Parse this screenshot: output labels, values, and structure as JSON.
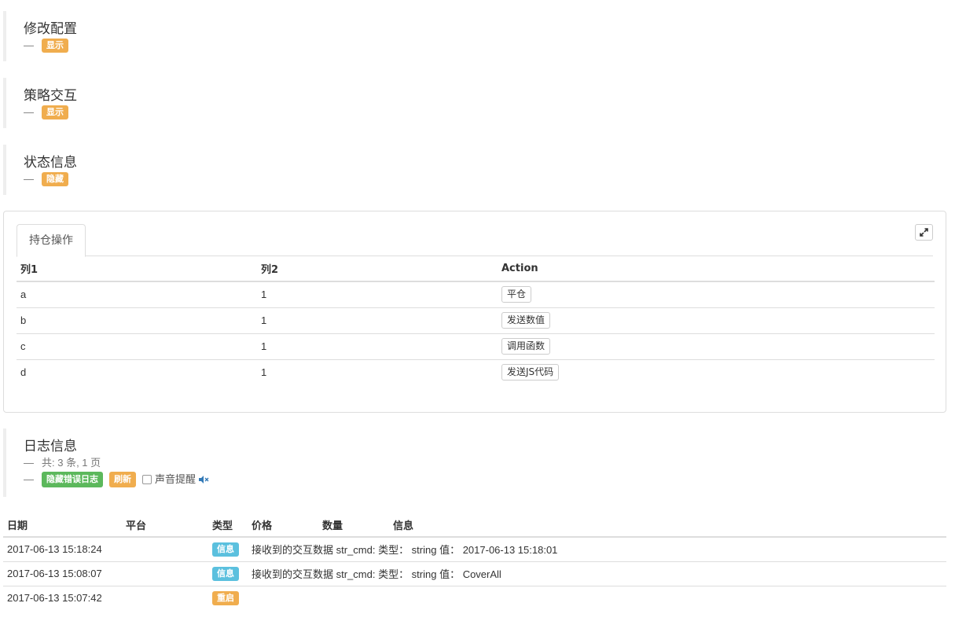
{
  "sections": {
    "config": {
      "title": "修改配置",
      "dash": "—",
      "toggle": "显示"
    },
    "interaction": {
      "title": "策略交互",
      "dash": "—",
      "toggle": "显示"
    },
    "status": {
      "title": "状态信息",
      "dash": "—",
      "toggle": "隐藏"
    }
  },
  "panel": {
    "tab": "持仓操作",
    "expand_icon": "expand-icon",
    "columns": [
      "列1",
      "列2",
      "Action"
    ],
    "rows": [
      {
        "c1": "a",
        "c2": "1",
        "action": "平仓"
      },
      {
        "c1": "b",
        "c2": "1",
        "action": "发送数值"
      },
      {
        "c1": "c",
        "c2": "1",
        "action": "调用函数"
      },
      {
        "c1": "d",
        "c2": "1",
        "action": "发送JS代码"
      }
    ]
  },
  "logs_section": {
    "title": "日志信息",
    "dash": "—",
    "summary": "共: 3 条, 1 页",
    "hide_errors": "隐藏错误日志",
    "refresh": "刷新",
    "sound_label": "声音提醒",
    "sound_icon": "speaker-muted-icon"
  },
  "logs": {
    "columns": [
      "日期",
      "平台",
      "类型",
      "价格",
      "数量",
      "信息"
    ],
    "rows": [
      {
        "date": "2017-06-13 15:18:24",
        "platform": "",
        "type": "信息",
        "type_color": "#5bc0de",
        "price": "",
        "amount": "",
        "info": "接收到的交互数据 str_cmd: 类型： string 值： 2017-06-13 15:18:01"
      },
      {
        "date": "2017-06-13 15:08:07",
        "platform": "",
        "type": "信息",
        "type_color": "#5bc0de",
        "price": "",
        "amount": "",
        "info": "接收到的交互数据 str_cmd: 类型： string 值： CoverAll"
      },
      {
        "date": "2017-06-13 15:07:42",
        "platform": "",
        "type": "重启",
        "type_color": "#f0ad4e",
        "price": "",
        "amount": "",
        "info": ""
      }
    ]
  }
}
